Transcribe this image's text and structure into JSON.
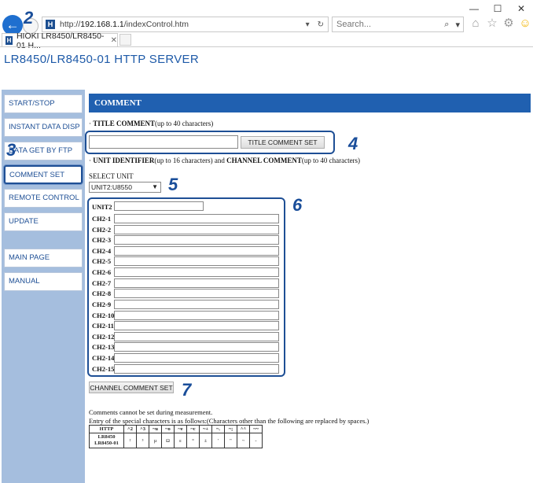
{
  "window": {
    "minimize": "—",
    "maximize": "☐",
    "close": "✕"
  },
  "browser": {
    "address_prefix": "http://",
    "address_host": "192.168.1.1",
    "address_path": "/indexControl.htm",
    "search_placeholder": "Search...",
    "tab_title": "HIOKI LR8450/LR8450-01 H...",
    "favicon_letter": "H"
  },
  "callouts": [
    "2",
    "3",
    "4",
    "5",
    "6",
    "7"
  ],
  "page": {
    "server_title": "LR8450/LR8450-01 HTTP SERVER"
  },
  "sidebar": {
    "items": [
      {
        "label": "START/STOP"
      },
      {
        "label": "INSTANT DATA DISP"
      },
      {
        "label": "DATA GET BY FTP"
      },
      {
        "label": "COMMENT SET"
      },
      {
        "label": "REMOTE CONTROL"
      },
      {
        "label": "UPDATE"
      },
      {
        "label": "MAIN PAGE"
      },
      {
        "label": "MANUAL"
      }
    ]
  },
  "comment": {
    "heading": "COMMENT",
    "title_comment_label": "TITLE COMMENT",
    "title_comment_hint": "(up to 40 characters)",
    "title_comment_value": "",
    "title_set_button": "TITLE COMMENT SET",
    "unit_identifier_label": "UNIT IDENTIFIER",
    "unit_identifier_hint": "(up to 16 characters) and ",
    "channel_comment_label": "CHANNEL COMMENT",
    "channel_comment_hint": "(up to 40 characters)",
    "select_unit_label": "SELECT UNIT",
    "select_unit_value": "UNIT2:U8550",
    "unit_row_label": "UNIT2",
    "channels": [
      "CH2-1",
      "CH2-2",
      "CH2-3",
      "CH2-4",
      "CH2-5",
      "CH2-6",
      "CH2-7",
      "CH2-8",
      "CH2-9",
      "CH2-10",
      "CH2-11",
      "CH2-12",
      "CH2-13",
      "CH2-14",
      "CH2-15"
    ],
    "channel_set_button": "CHANNEL COMMENT SET",
    "note_1": "Comments cannot be set during measurement.",
    "note_2": "Entry of the special characters is as follows:(Characters other than the following are replaced by spaces.)",
    "table_header": [
      "HTTP",
      "^2",
      "^3",
      "~u",
      "~o",
      "~e",
      "~c",
      "~+",
      "~.",
      "~;",
      "^^",
      "~~"
    ],
    "table_row_head": [
      "LR8450",
      "LR8450-01"
    ],
    "table_row": [
      "²",
      "³",
      "µ",
      "Ω",
      "ε",
      "°",
      "±",
      "'",
      "\"",
      "~",
      "-"
    ]
  }
}
